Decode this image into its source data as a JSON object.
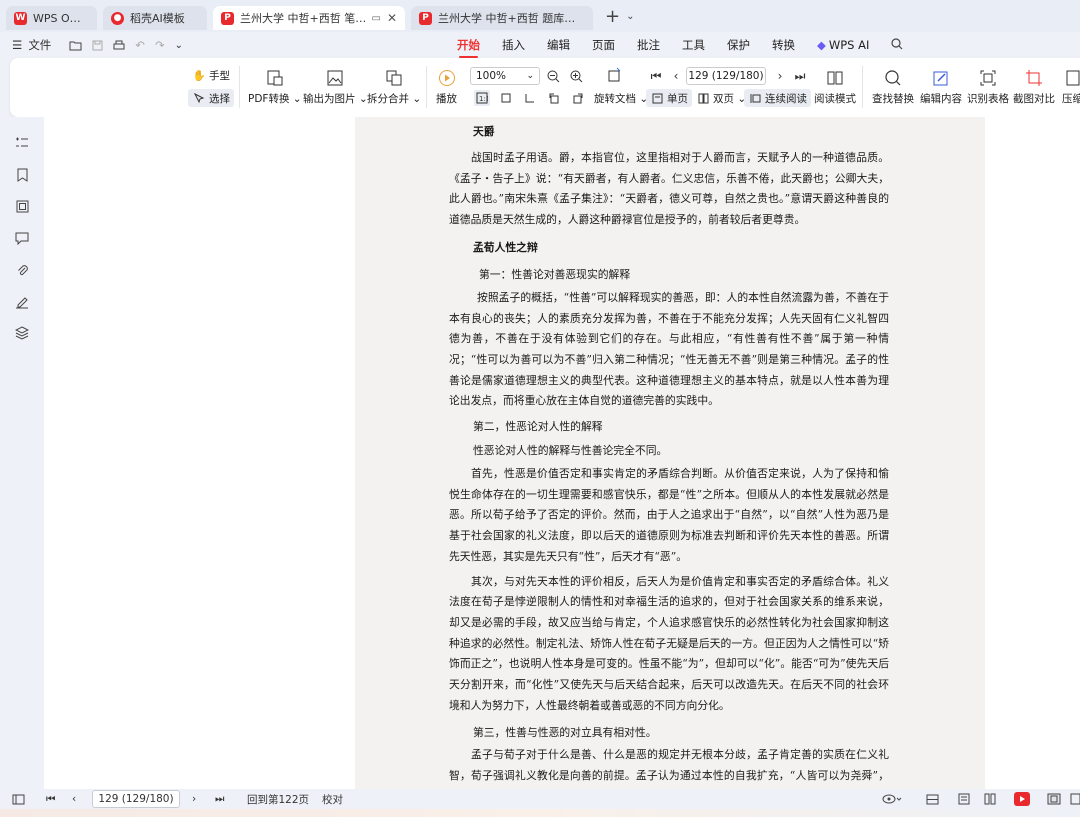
{
  "tabs": [
    {
      "label": "WPS Office",
      "icon": "wps-logo-icon",
      "active": false
    },
    {
      "label": "稻壳AI模板",
      "icon": "daoke-logo-icon",
      "active": false
    },
    {
      "label": "兰州大学 中哲+西哲 笔记.pd",
      "icon": "pdf-icon",
      "active": true
    },
    {
      "label": "兰州大学 中哲+西哲 题库附解析.pd",
      "icon": "pdf-icon",
      "active": false
    }
  ],
  "menubar": {
    "file_label": "文件",
    "tabs": [
      "开始",
      "插入",
      "编辑",
      "页面",
      "批注",
      "工具",
      "保护",
      "转换",
      "WPS AI"
    ],
    "active_tab": "开始"
  },
  "ribbon": {
    "hand": "手型",
    "select": "选择",
    "pdf_convert": "PDF转换",
    "export_image": "输出为图片",
    "split_merge": "拆分合并",
    "play": "播放",
    "zoom": "100%",
    "page_indicator": "129 (129/180)",
    "rotate": "旋转文档",
    "single": "单页",
    "double": "双页",
    "continuous": "连续阅读",
    "reading_mode": "阅读模式",
    "find_replace": "查找替换",
    "edit_content": "编辑内容",
    "recognize_table": "识别表格",
    "screenshot_compare": "截图对比",
    "compress": "压缩"
  },
  "document": {
    "h1": "天爵",
    "p1": "战国时孟子用语。爵，本指官位，这里指相对于人爵而言，天赋予人的一种道德品质。《孟子・告子上》说：“有天爵者，有人爵者。仁义忠信，乐善不倦，此天爵也；公卿大夫，此人爵也。”南宋朱熹《孟子集注》：“天爵者，德义可尊，自然之贵也。”意谓天爵这种善良的道德品质是天然生成的，人爵这种爵禄官位是授予的，前者较后者更尊贵。",
    "h2": "孟荀人性之辩",
    "s1": "第一：性善论对善恶现实的解释",
    "p2": "按照孟子的概括，“性善”可以解释现实的善恶，即：人的本性自然流露为善，不善在于本有良心的丧失；人的素质充分发挥为善，不善在于不能充分发挥；人先天固有仁义礼智四德为善，不善在于没有体验到它们的存在。与此相应，“有性善有性不善”属于第一种情况；“性可以为善可以为不善”归入第二种情况；“性无善无不善”则是第三种情况。孟子的性善论是儒家道德理想主义的典型代表。这种道德理想主义的基本特点，就是以人性本善为理论出发点，而将重心放在主体自觉的道德完善的实践中。",
    "s2": "第二，性恶论对人性的解释",
    "s3": "性恶论对人性的解释与性善论完全不同。",
    "p3": "首先，性恶是价值否定和事实肯定的矛盾综合判断。从价值否定来说，人为了保持和愉悦生命体存在的一切生理需要和感官快乐，都是“性”之所本。但顺从人的本性发展就必然是恶。所以荀子给予了否定的评价。然而，由于人之追求出于“自然”，以“自然”人性为恶乃是基于社会国家的礼义法度，即以后天的道德原则为标准去判断和评价先天本性的善恶。所谓先天性恶，其实是先天只有“性”，后天才有“恶”。",
    "p4": "其次，与对先天本性的评价相反，后天人为是价值肯定和事实否定的矛盾综合体。礼义法度在荀子是悖逆限制人的情性和对幸福生活的追求的，但对于社会国家关系的维系来说，却又是必需的手段，故又应当给与肯定，个人追求感官快乐的必然性转化为社会国家抑制这种追求的必然性。制定礼法、矫饰人性在荀子无疑是后天的一方。但正因为人之情性可以“矫饰而正之”，也说明人性本身是可变的。性虽不能“为”，但却可以“化”。能否“可为”使先天后天分割开来，而“化性”又使先天与后天结合起来，后天可以改造先天。在后天不同的社会环境和人为努力下，人性最终朝着或善或恶的不同方向分化。",
    "s4": "第三，性善与性恶的对立具有相对性。",
    "p5": "孟子与荀子对于什么是善、什么是恶的规定并无根本分歧，孟子肯定善的实质在仁义礼智，荀子强调礼义教化是向善的前提。孟子认为通过本性的自我扩充，“人皆可以为尧舜”，荀子则认为通过化性起伪，“涂之人可以为禹”，二者都肯定了人能够通过自身努力成为圣贤。"
  },
  "statusbar": {
    "page_indicator": "129 (129/180)",
    "goto": "回到第122页",
    "proofread": "校对"
  },
  "colors": {
    "accent": "#e33333",
    "wps_red": "#e8292d",
    "ai_purple": "#6b5cf6"
  }
}
